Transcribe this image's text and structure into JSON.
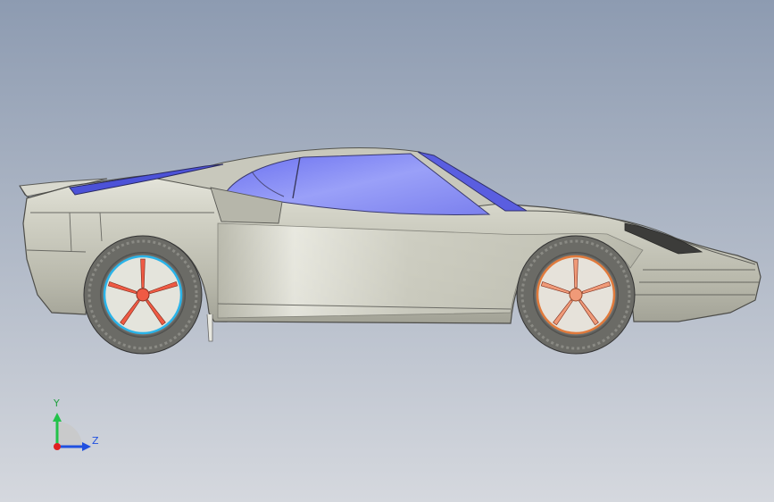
{
  "viewport": {
    "background_top": "#8d9bb1",
    "background_bottom": "#d5d8de"
  },
  "model": {
    "body_color": "#c4c4b6",
    "glass_color": "#7a7ff2",
    "rear_wheel_rim_color": "#ef5a44",
    "rear_wheel_ring_color": "#2ab3e8",
    "front_wheel_rim_color": "#f09a78",
    "front_wheel_ring_color": "#e07a3c",
    "tire_color": "#5a5a5a"
  },
  "triad": {
    "y_label": "Y",
    "z_label": "Z",
    "y_color": "#22c24a",
    "z_color": "#2050e0",
    "origin_color": "#e02020"
  }
}
